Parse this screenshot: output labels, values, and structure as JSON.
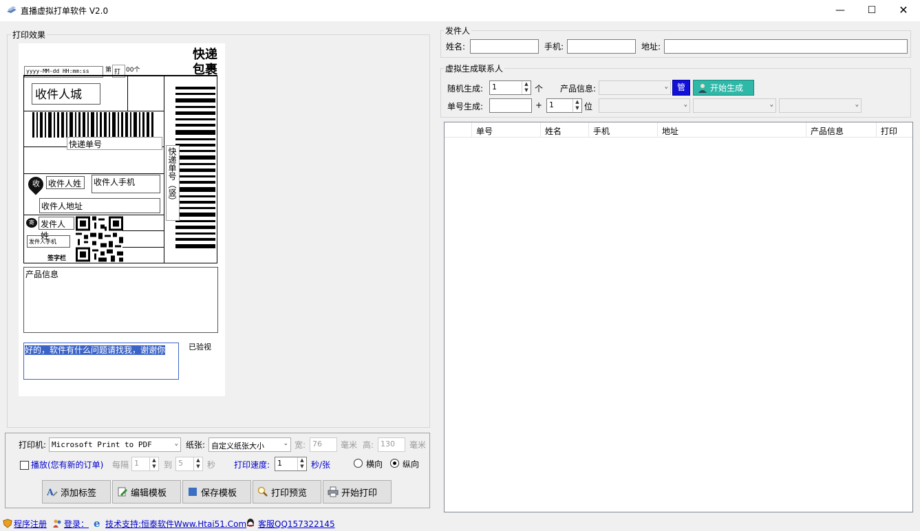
{
  "window": {
    "title": "直播虚拟打单软件 V2.0"
  },
  "print_preview": {
    "group_label": "打印效果",
    "label": {
      "datetime": "yyyy-MM-dd HH:mm:ss",
      "print_no_prefix": "第",
      "print_no_box": "打",
      "print_no_suffix": "00个",
      "title_line1": "快递",
      "title_line2": "包裹",
      "recipient_city": "收件人城",
      "tracking_no": "快递单号",
      "tracking_vertical": "快递单号（竖）",
      "recipient_badge": "收",
      "recipient_name": "收件人姓",
      "recipient_phone": "收件人手机",
      "recipient_address": "收件人地址",
      "sender_badge": "寄",
      "sender_name": "发件人姓",
      "sender_phone": "发件人手机",
      "signature": "签字栏",
      "product_info": "产品信息",
      "message": "好的，软件有什么问题请找我，谢谢你",
      "inspected": "已验视"
    }
  },
  "sender": {
    "group_label": "发件人",
    "name_label": "姓名:",
    "phone_label": "手机:",
    "address_label": "地址:",
    "name_value": "",
    "phone_value": "",
    "address_value": ""
  },
  "virtual": {
    "group_label": "虚拟生成联系人",
    "random_label": "随机生成:",
    "random_value": "1",
    "random_unit": "个",
    "product_label": "产品信息:",
    "manage_button": "管",
    "generate_button": "开始生成",
    "tracking_label": "单号生成:",
    "tracking_value": "",
    "plus": "+",
    "digits_value": "1",
    "digits_unit": "位"
  },
  "table": {
    "columns": [
      "",
      "单号",
      "姓名",
      "手机",
      "地址",
      "产品信息",
      "打印"
    ],
    "rows": []
  },
  "print_settings": {
    "printer_label": "打印机:",
    "printer_value": "Microsoft Print to PDF",
    "paper_label": "纸张:",
    "paper_value": "自定义纸张大小",
    "width_label": "宽:",
    "width_value": "76",
    "height_label": "高:",
    "height_value": "130",
    "unit_mm": "毫米",
    "broadcast_label": "播放(您有新的订单)",
    "every_label": "每隔",
    "every_value": "1",
    "to_label": "到",
    "to_value": "5",
    "seconds_label": "秒",
    "speed_label": "打印速度:",
    "speed_value": "1",
    "speed_unit": "秒/张",
    "landscape": "横向",
    "portrait": "纵向"
  },
  "buttons": {
    "add_tag": "添加标签",
    "edit_template": "编辑模板",
    "save_template": "保存模板",
    "print_preview": "打印预览",
    "start_print": "开始打印"
  },
  "statusbar": {
    "register": "程序注册",
    "login": "登录：",
    "support": "技术支持:恒泰软件Www.Htai51.Com",
    "service": "客服QQ157322145"
  }
}
